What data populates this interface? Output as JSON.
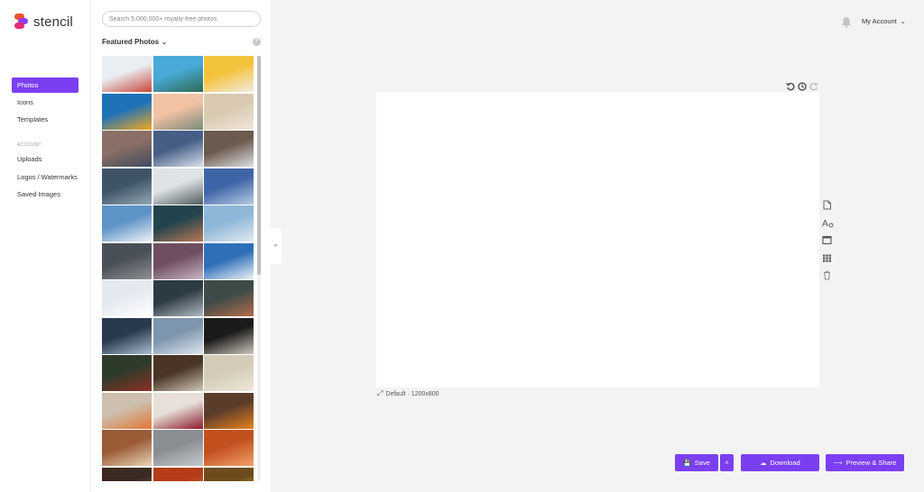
{
  "brand": {
    "name": "stencil"
  },
  "nav": {
    "items": [
      {
        "label": "Photos",
        "active": true
      },
      {
        "label": "Icons"
      },
      {
        "label": "Templates"
      }
    ],
    "section_label": "ACCOUNT",
    "account_items": [
      {
        "label": "Uploads"
      },
      {
        "label": "Logos / Watermarks"
      },
      {
        "label": "Saved Images"
      }
    ]
  },
  "panel": {
    "search_placeholder": "Search 5,000,000+ royalty-free photos",
    "heading": "Featured Photos",
    "help_label": "?",
    "photos": [
      {
        "name": "ferris-wheel",
        "c1": "#e9eef3",
        "c2": "#c9463a"
      },
      {
        "name": "palm-trees-sky",
        "c1": "#49a9d8",
        "c2": "#2d6a4f"
      },
      {
        "name": "ice-cream-yellow",
        "c1": "#f4c33c",
        "c2": "#f1ece4"
      },
      {
        "name": "yellow-flowers",
        "c1": "#1f72b8",
        "c2": "#f3a91c"
      },
      {
        "name": "palm-sunset",
        "c1": "#f2c2a4",
        "c2": "#7a8a7a"
      },
      {
        "name": "beach-umbrellas",
        "c1": "#d9c9b0",
        "c2": "#efe6dc"
      },
      {
        "name": "city-bridge",
        "c1": "#8a6f66",
        "c2": "#3f4a5e"
      },
      {
        "name": "snowy-mountain-lake",
        "c1": "#465e86",
        "c2": "#d9e1ec"
      },
      {
        "name": "rocky-mountain-snow",
        "c1": "#6b5a4e",
        "c2": "#dcdfe2"
      },
      {
        "name": "frozen-river",
        "c1": "#3e5466",
        "c2": "#94a6b4"
      },
      {
        "name": "foggy-forest",
        "c1": "#dfe3e6",
        "c2": "#4e5b5e"
      },
      {
        "name": "frost-bubble",
        "c1": "#3d64a6",
        "c2": "#b8cbe4"
      },
      {
        "name": "snowy-trees",
        "c1": "#5e93c7",
        "c2": "#eef2f6"
      },
      {
        "name": "winter-cabin",
        "c1": "#22444c",
        "c2": "#b97757"
      },
      {
        "name": "snow-drifts",
        "c1": "#8eb6d8",
        "c2": "#e1ebf2"
      },
      {
        "name": "dark-waves",
        "c1": "#4a5058",
        "c2": "#8f8f94"
      },
      {
        "name": "frosty-leaves",
        "c1": "#6e4e60",
        "c2": "#c9b6c6"
      },
      {
        "name": "snow-slope",
        "c1": "#2f6fb8",
        "c2": "#f0f4f8"
      },
      {
        "name": "arctic-fox",
        "c1": "#e4e9f0",
        "c2": "#ffffff"
      },
      {
        "name": "coffee-cup",
        "c1": "#2c3a44",
        "c2": "#b0bac2"
      },
      {
        "name": "pine-cones",
        "c1": "#3d4a48",
        "c2": "#b36d4a"
      },
      {
        "name": "frozen-lake",
        "c1": "#2a3a4e",
        "c2": "#a9bcd0"
      },
      {
        "name": "frosted-pines",
        "c1": "#7d96ae",
        "c2": "#dfe6ee"
      },
      {
        "name": "pine-cones-dark",
        "c1": "#1b1b1b",
        "c2": "#cfc7bb"
      },
      {
        "name": "chickens",
        "c1": "#2f3b2a",
        "c2": "#8c3026"
      },
      {
        "name": "spices-table",
        "c1": "#4a3426",
        "c2": "#cfc6b6"
      },
      {
        "name": "bread-flat",
        "c1": "#d4cbb8",
        "c2": "#efe8d8"
      },
      {
        "name": "pumpkin-hands",
        "c1": "#cdbfae",
        "c2": "#e07733"
      },
      {
        "name": "berries-bowl",
        "c1": "#e6e0d8",
        "c2": "#8a1826"
      },
      {
        "name": "sunflower-wood",
        "c1": "#5b3c2a",
        "c2": "#e8831f"
      },
      {
        "name": "autumn-table",
        "c1": "#9a5b36",
        "c2": "#e8d2b4"
      },
      {
        "name": "foggy-road",
        "c1": "#8a8e92",
        "c2": "#c8cbce"
      },
      {
        "name": "peaches",
        "c1": "#c2501f",
        "c2": "#f3a36a"
      },
      {
        "name": "cozy-room",
        "c1": "#3b2a22",
        "c2": "#9a6c48"
      },
      {
        "name": "autumn-leaves",
        "c1": "#b43c16",
        "c2": "#e98a2b"
      },
      {
        "name": "golden-trees",
        "c1": "#6e4b1c",
        "c2": "#e8b84a"
      }
    ]
  },
  "header": {
    "account_label": "My Account"
  },
  "canvas": {
    "size_label": "Default · 1200x800"
  },
  "buttons": {
    "save": "Save",
    "download": "Download",
    "preview": "Preview & Share"
  },
  "colors": {
    "accent": "#7b3ff2"
  }
}
